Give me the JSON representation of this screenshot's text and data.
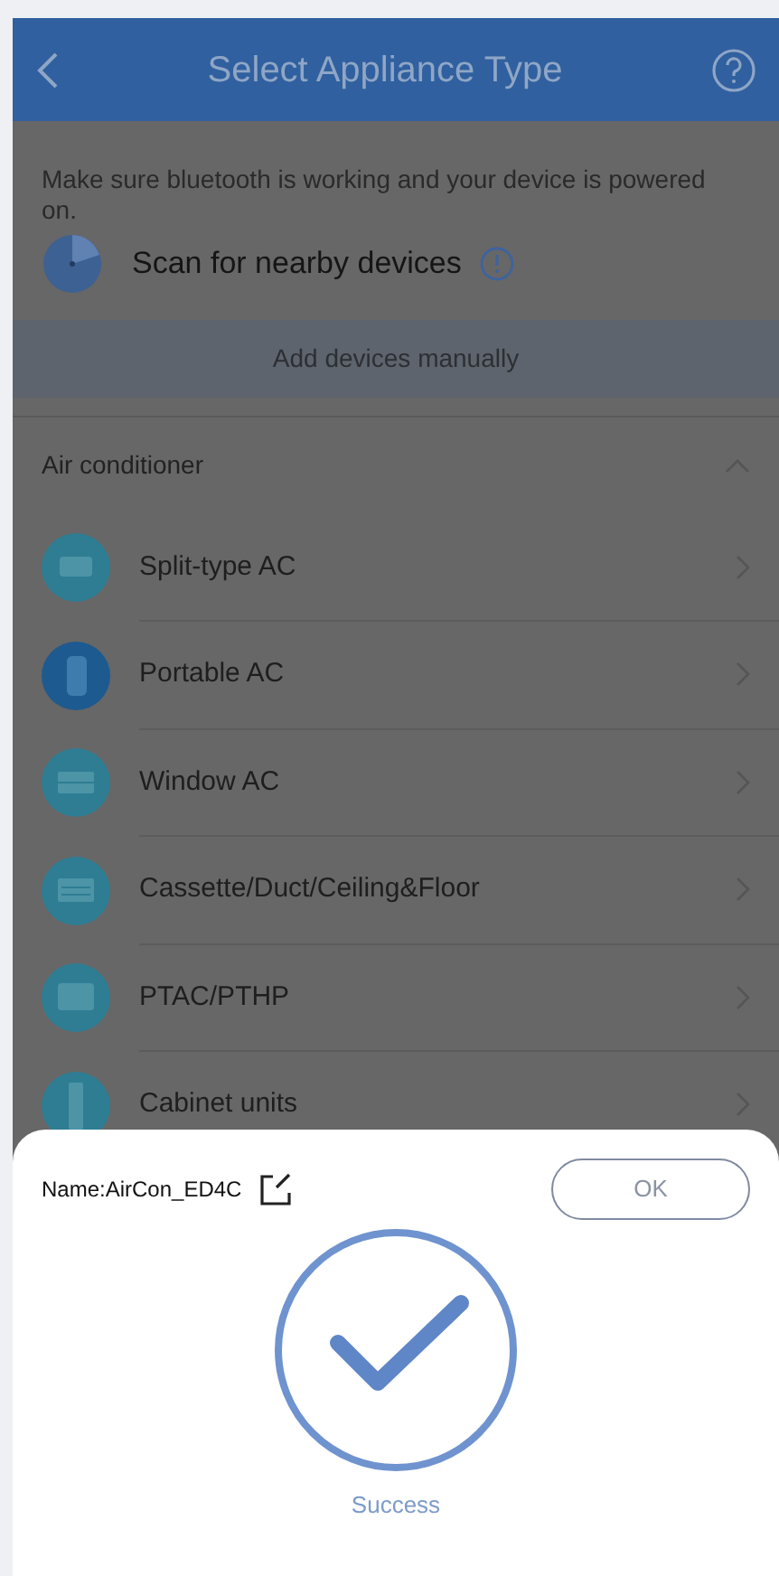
{
  "header": {
    "title": "Select Appliance Type"
  },
  "hint": "Make sure bluetooth is working and your device is powered on.",
  "scan": {
    "label": "Scan for nearby devices"
  },
  "manual_tab": {
    "label": "Add devices manually"
  },
  "category": {
    "label": "Air conditioner",
    "expanded": true,
    "items": [
      {
        "label": "Split-type AC"
      },
      {
        "label": "Portable AC"
      },
      {
        "label": "Window AC"
      },
      {
        "label": "Cassette/Duct/Ceiling&Floor"
      },
      {
        "label": "PTAC/PTHP"
      },
      {
        "label": "Cabinet units"
      }
    ]
  },
  "dialog": {
    "name": "Name:AirCon_ED4C",
    "ok": "OK",
    "status": "Success"
  }
}
